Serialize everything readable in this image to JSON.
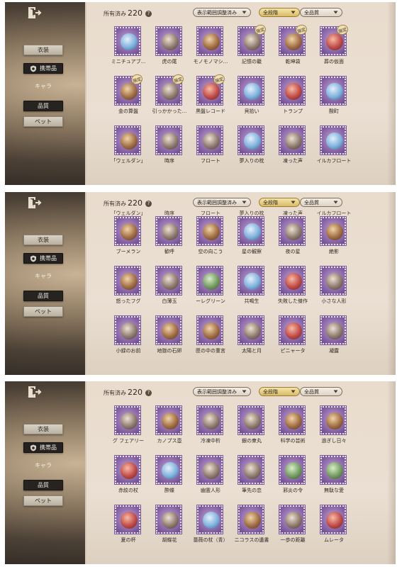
{
  "screens": [
    {
      "owned_label": "所有済み",
      "owned_count": "220",
      "filters": {
        "range": "表示範囲調整済み",
        "stage": "全段階",
        "quality": "全品質"
      },
      "sidebar": {
        "costume": "衣装",
        "carried": "携帯品",
        "chara": "キャラ",
        "quality": "品質",
        "pet": "ペット"
      },
      "items": [
        {
          "label": "ミニチュアブ...",
          "badge": "",
          "tone": "blue"
        },
        {
          "label": "虎の尾",
          "badge": "",
          "tone": ""
        },
        {
          "label": "モノモノマシ...",
          "badge": "",
          "tone": "brown"
        },
        {
          "label": "記憶の籠",
          "badge": "限定",
          "tone": ""
        },
        {
          "label": "乾坤袋",
          "badge": "限定",
          "tone": "brown"
        },
        {
          "label": "葬の仮面",
          "badge": "限定",
          "tone": "red"
        },
        {
          "label": "金の算盤",
          "badge": "限定",
          "tone": "brown"
        },
        {
          "label": "引っかかった...",
          "badge": "限定",
          "tone": ""
        },
        {
          "label": "黒盤レコード",
          "badge": "限定",
          "tone": "red"
        },
        {
          "label": "貝拾い",
          "badge": "",
          "tone": "blue"
        },
        {
          "label": "トランプ",
          "badge": "",
          "tone": "red"
        },
        {
          "label": "酸町",
          "badge": "",
          "tone": "blue"
        },
        {
          "label": "「ウェルダン」",
          "badge": "",
          "tone": "brown"
        },
        {
          "label": "時序",
          "badge": "",
          "tone": ""
        },
        {
          "label": "フロート",
          "badge": "",
          "tone": ""
        },
        {
          "label": "夢入りの枕",
          "badge": "",
          "tone": "blue"
        },
        {
          "label": "凍った声",
          "badge": "",
          "tone": ""
        },
        {
          "label": "イルカフロート",
          "badge": "",
          "tone": "blue"
        }
      ]
    },
    {
      "owned_label": "所有済み",
      "owned_count": "220",
      "filters": {
        "range": "表示範囲調整済み",
        "stage": "全段階",
        "quality": "全品質"
      },
      "sidebar": {
        "costume": "衣装",
        "carried": "携帯品",
        "chara": "キャラ",
        "quality": "品質",
        "pet": "ペット"
      },
      "ghost": [
        "「ウェルダン」",
        "時序",
        "フロート",
        "夢入りの枕",
        "凍った声",
        "イルカフロート"
      ],
      "items": [
        {
          "label": "ブーメラン",
          "badge": "",
          "tone": "brown"
        },
        {
          "label": "歓呼",
          "badge": "",
          "tone": ""
        },
        {
          "label": "空の向こう",
          "badge": "",
          "tone": "brown"
        },
        {
          "label": "星の観察",
          "badge": "",
          "tone": "blue"
        },
        {
          "label": "夜の星",
          "badge": "",
          "tone": ""
        },
        {
          "label": "絶影",
          "badge": "",
          "tone": "brown"
        },
        {
          "label": "怒ったフグ",
          "badge": "",
          "tone": "brown"
        },
        {
          "label": "白薄玉",
          "badge": "",
          "tone": ""
        },
        {
          "label": "ーレグリーン",
          "badge": "",
          "tone": "green"
        },
        {
          "label": "共鳴生",
          "badge": "",
          "tone": "blue"
        },
        {
          "label": "失敗した傑作",
          "badge": "",
          "tone": "red"
        },
        {
          "label": "小さな人形",
          "badge": "",
          "tone": ""
        },
        {
          "label": "小録のお前",
          "badge": "",
          "tone": ""
        },
        {
          "label": "地獄の石卵",
          "badge": "",
          "tone": "brown"
        },
        {
          "label": "匣の中の重言",
          "badge": "",
          "tone": "brown"
        },
        {
          "label": "太陽と月",
          "badge": "",
          "tone": ""
        },
        {
          "label": "ピニャータ",
          "badge": "",
          "tone": "red"
        },
        {
          "label": "凝露",
          "badge": "",
          "tone": ""
        }
      ]
    },
    {
      "owned_label": "所有済み",
      "owned_count": "220",
      "filters": {
        "range": "表示範囲調整済み",
        "stage": "全段階",
        "quality": "全品質"
      },
      "sidebar": {
        "costume": "衣装",
        "carried": "携帯品",
        "chara": "キャラ",
        "quality": "品質",
        "pet": "ペット"
      },
      "items": [
        {
          "label": "グ フェアリー",
          "badge": "",
          "tone": ""
        },
        {
          "label": "カノプス壺",
          "badge": "",
          "tone": "brown"
        },
        {
          "label": "冷凍中析",
          "badge": "",
          "tone": ""
        },
        {
          "label": "銀の衆丸",
          "badge": "",
          "tone": ""
        },
        {
          "label": "科学の芸術",
          "badge": "",
          "tone": "brown"
        },
        {
          "label": "過ぎし日々",
          "badge": "",
          "tone": "brown"
        },
        {
          "label": "赤紋の杖",
          "badge": "",
          "tone": "red"
        },
        {
          "label": "酔蝶",
          "badge": "",
          "tone": "blue"
        },
        {
          "label": "幽霊人形",
          "badge": "",
          "tone": ""
        },
        {
          "label": "筆先の恋",
          "badge": "",
          "tone": ""
        },
        {
          "label": "邪炎の令",
          "badge": "",
          "tone": "green"
        },
        {
          "label": "無駄な愛",
          "badge": "",
          "tone": "green"
        },
        {
          "label": "夏の杯",
          "badge": "",
          "tone": "red"
        },
        {
          "label": "胡蝶花",
          "badge": "",
          "tone": ""
        },
        {
          "label": "薔薇の杖（青）",
          "badge": "",
          "tone": "blue"
        },
        {
          "label": "ニコラスの遺書",
          "badge": "",
          "tone": "brown"
        },
        {
          "label": "一歩の距離",
          "badge": "",
          "tone": ""
        },
        {
          "label": "ムレータ",
          "badge": "",
          "tone": "red"
        }
      ]
    }
  ]
}
